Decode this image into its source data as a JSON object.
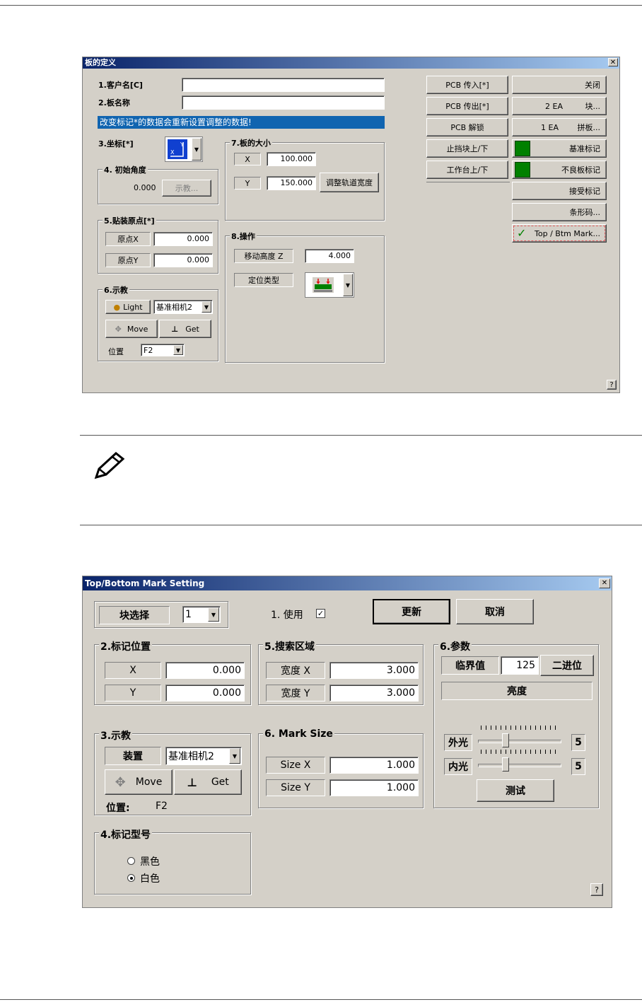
{
  "board_dialog": {
    "title": "板的定义",
    "customer_label": "1.客户名[C]",
    "board_name_label": "2.板名称",
    "warning": "改变标记*的数据会重新设置调整的数据!",
    "coord_label": "3.坐标[*]",
    "initial_angle": {
      "group": "4. 初始角度",
      "value": "0.000",
      "teach_btn": "示教..."
    },
    "origin": {
      "group": "5.贴装原点[*]",
      "x_label": "原点X",
      "x_value": "0.000",
      "y_label": "原点Y",
      "y_value": "0.000"
    },
    "teach": {
      "group": "6.示教",
      "light_btn": "Light",
      "camera_select": "基准相机2",
      "move_btn": "Move",
      "get_btn": "Get",
      "pos_label": "位置",
      "pos_select": "F2"
    },
    "board_size": {
      "group": "7.板的大小",
      "x_label": "X",
      "x_value": "100.000",
      "y_label": "Y",
      "y_value": "150.000",
      "adjust_btn": "调整轨道宽度"
    },
    "operation": {
      "group": "8.操作",
      "move_height_label": "移动高度 Z",
      "move_height_value": "4.000",
      "locate_type_label": "定位类型"
    },
    "right_buttons": {
      "pcb_in": "PCB 传入[*]",
      "pcb_out": "PCB 传出[*]",
      "pcb_lock": "PCB 解锁",
      "stopper": "止挡块上/下",
      "table": "工作台上/下",
      "close": "关闭",
      "ea2_count": "2 EA",
      "ea2_label": "块...",
      "ea1_count": "1 EA",
      "ea1_label": "拼板...",
      "fiducial": "基准标记",
      "bad_mark": "不良板标记",
      "accept_mark": "接受标记",
      "barcode": "条形码...",
      "top_btm": "Top / Btm Mark..."
    },
    "help": "?"
  },
  "mark_dialog": {
    "title": "Top/Bottom Mark Setting",
    "block_select_label": "块选择",
    "block_select_value": "1",
    "use_label": "1. 使用",
    "update_btn": "更新",
    "cancel_btn": "取消",
    "mark_pos": {
      "group": "2.标记位置",
      "x_label": "X",
      "x_value": "0.000",
      "y_label": "Y",
      "y_value": "0.000"
    },
    "search_area": {
      "group": "5.搜索区域",
      "wx_label": "宽度 X",
      "wx_value": "3.000",
      "wy_label": "宽度 Y",
      "wy_value": "3.000"
    },
    "params": {
      "group": "6.参数",
      "threshold_label": "临界值",
      "threshold_value": "125",
      "binary_btn": "二进位",
      "brightness_label": "亮度",
      "outer_label": "外光",
      "outer_value": "5",
      "inner_label": "内光",
      "inner_value": "5",
      "test_btn": "测试"
    },
    "teach": {
      "group": "3.示教",
      "device_label": "装置",
      "device_select": "基准相机2",
      "move_btn": "Move",
      "get_btn": "Get",
      "pos_label": "位置:",
      "pos_value": "F2"
    },
    "mark_size": {
      "group": "6. Mark Size",
      "sx_label": "Size X",
      "sx_value": "1.000",
      "sy_label": "Size Y",
      "sy_value": "1.000"
    },
    "mark_type": {
      "group": "4.标记型号",
      "black": "黑色",
      "white": "白色",
      "selected": "白色"
    },
    "help": "?"
  },
  "colors": {
    "title_start": "#0a246a",
    "title_end": "#a6caf0",
    "face": "#d4d0c8",
    "warning_bg": "#1064b0",
    "green": "#008000"
  }
}
